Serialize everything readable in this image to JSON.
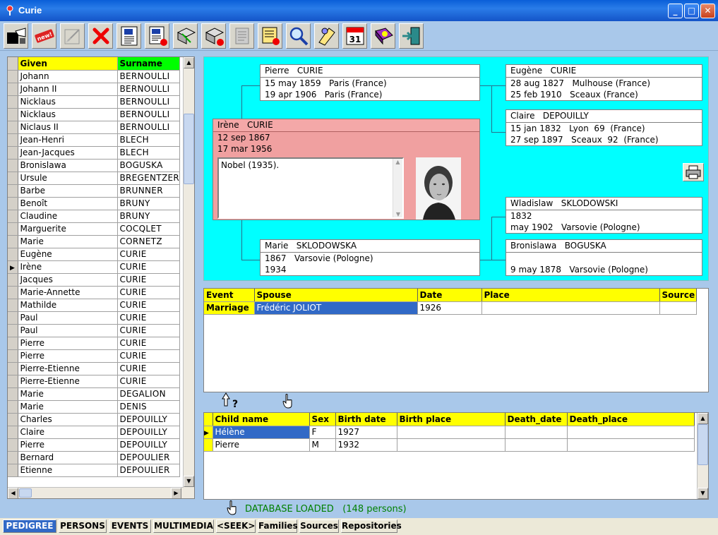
{
  "window": {
    "title": "Curie"
  },
  "toolbar": {
    "buttons": [
      {
        "icon": "connect-icon"
      },
      {
        "icon": "new-icon"
      },
      {
        "icon": "edit-disabled-icon"
      },
      {
        "icon": "delete-icon"
      },
      {
        "icon": "text-document-icon"
      },
      {
        "icon": "text-document-red-icon"
      },
      {
        "icon": "export-icon"
      },
      {
        "icon": "export-delete-icon"
      },
      {
        "icon": "scroll-icon"
      },
      {
        "icon": "report-icon"
      },
      {
        "icon": "search-icon"
      },
      {
        "icon": "notes-icon"
      },
      {
        "icon": "calendar-icon"
      },
      {
        "icon": "help-book-icon"
      },
      {
        "icon": "exit-icon"
      }
    ],
    "calendar_day": "31",
    "new_label": "new!"
  },
  "person_list": {
    "headers": {
      "given": "Given",
      "surname": "Surname"
    },
    "rows": [
      {
        "given": "Johann",
        "surname": "BERNOULLI"
      },
      {
        "given": "Johann II",
        "surname": "BERNOULLI"
      },
      {
        "given": "Nicklaus",
        "surname": "BERNOULLI"
      },
      {
        "given": "Nicklaus",
        "surname": "BERNOULLI"
      },
      {
        "given": "Niclaus II",
        "surname": "BERNOULLI"
      },
      {
        "given": "Jean-Henri",
        "surname": "BLECH"
      },
      {
        "given": "Jean-Jacques",
        "surname": "BLECH"
      },
      {
        "given": "Bronislawa",
        "surname": "BOGUSKA"
      },
      {
        "given": "Ursule",
        "surname": "BREGENTZER"
      },
      {
        "given": "Barbe",
        "surname": "BRUNNER"
      },
      {
        "given": "Benoît",
        "surname": "BRUNY"
      },
      {
        "given": "Claudine",
        "surname": "BRUNY"
      },
      {
        "given": "Marguerite",
        "surname": "COCQLET"
      },
      {
        "given": "Marie",
        "surname": "CORNETZ"
      },
      {
        "given": "Eugène",
        "surname": "CURIE"
      },
      {
        "given": "Irène",
        "surname": "CURIE",
        "current": true
      },
      {
        "given": "Jacques",
        "surname": "CURIE"
      },
      {
        "given": "Marie-Annette",
        "surname": "CURIE"
      },
      {
        "given": "Mathilde",
        "surname": "CURIE"
      },
      {
        "given": "Paul",
        "surname": "CURIE"
      },
      {
        "given": "Paul",
        "surname": "CURIE"
      },
      {
        "given": "Pierre",
        "surname": "CURIE"
      },
      {
        "given": "Pierre",
        "surname": "CURIE"
      },
      {
        "given": "Pierre-Etienne",
        "surname": "CURIE"
      },
      {
        "given": "Pierre-Etienne",
        "surname": "CURIE"
      },
      {
        "given": "Marie",
        "surname": "DEGALION"
      },
      {
        "given": "Marie",
        "surname": "DENIS"
      },
      {
        "given": "Charles",
        "surname": "DEPOUILLY"
      },
      {
        "given": "Claire",
        "surname": "DEPOUILLY"
      },
      {
        "given": "Pierre",
        "surname": "DEPOUILLY"
      },
      {
        "given": "Bernard",
        "surname": "DEPOULIER"
      },
      {
        "given": "Etienne",
        "surname": "DEPOULIER"
      }
    ]
  },
  "pedigree": {
    "subject": {
      "name": "Irène   CURIE",
      "birth": "12 sep 1867",
      "death": "17 mar 1956",
      "notes": "Nobel (1935)."
    },
    "father": {
      "name": "Pierre   CURIE",
      "line1": "15 may 1859   Paris (France)",
      "line2": "19 apr 1906   Paris (France)"
    },
    "mother": {
      "name": "Marie   SKLODOWSKA",
      "line1": "1867   Varsovie (Pologne)",
      "line2": "1934"
    },
    "paternal_grandfather": {
      "name": "Eugène   CURIE",
      "line1": "28 aug 1827   Mulhouse (France)",
      "line2": "25 feb 1910   Sceaux (France)"
    },
    "paternal_grandmother": {
      "name": "Claire   DEPOUILLY",
      "line1": "15 jan 1832   Lyon  69  (France)",
      "line2": "27 sep 1897   Sceaux  92  (France)"
    },
    "maternal_grandfather": {
      "name": "Wladislaw   SKLODOWSKI",
      "line1": "1832",
      "line2": "may 1902   Varsovie (Pologne)"
    },
    "maternal_grandmother": {
      "name": "Bronislawa   BOGUSKA",
      "line1": "",
      "line2": "9 may 1878   Varsovie (Pologne)"
    }
  },
  "events": {
    "headers": {
      "event": "Event",
      "spouse": "Spouse",
      "date": "Date",
      "place": "Place",
      "source": "Source"
    },
    "rows": [
      {
        "event": "Marriage",
        "spouse": "Frédéric   JOLIOT",
        "date": "1926",
        "place": "",
        "source": ""
      }
    ]
  },
  "children": {
    "headers": {
      "name": "Child name",
      "sex": "Sex",
      "birth_date": "Birth date",
      "birth_place": "Birth place",
      "death_date": "Death_date",
      "death_place": "Death_place"
    },
    "rows": [
      {
        "name": "Hélène",
        "sex": "F",
        "birth_date": "1927",
        "birth_place": "",
        "death_date": "",
        "death_place": ""
      },
      {
        "name": "Pierre",
        "sex": "M",
        "birth_date": "1932",
        "birth_place": "",
        "death_date": "",
        "death_place": ""
      }
    ]
  },
  "help_glyph": "?",
  "status": "DATABASE LOADED   (148 persons)",
  "tabs": [
    "PEDIGREE",
    "PERSONS",
    "EVENTS",
    "MULTIMEDIA",
    "<SEEK>",
    "Families",
    "Sources",
    "Repositories"
  ],
  "active_tab": "PEDIGREE",
  "colors": {
    "pedigree_bg": "#00ffff",
    "subject_bg": "#f0a0a0",
    "header_yellow": "#ffff00",
    "surname_header": "#00ff00",
    "selection": "#3169c6",
    "status_green": "#008000"
  }
}
